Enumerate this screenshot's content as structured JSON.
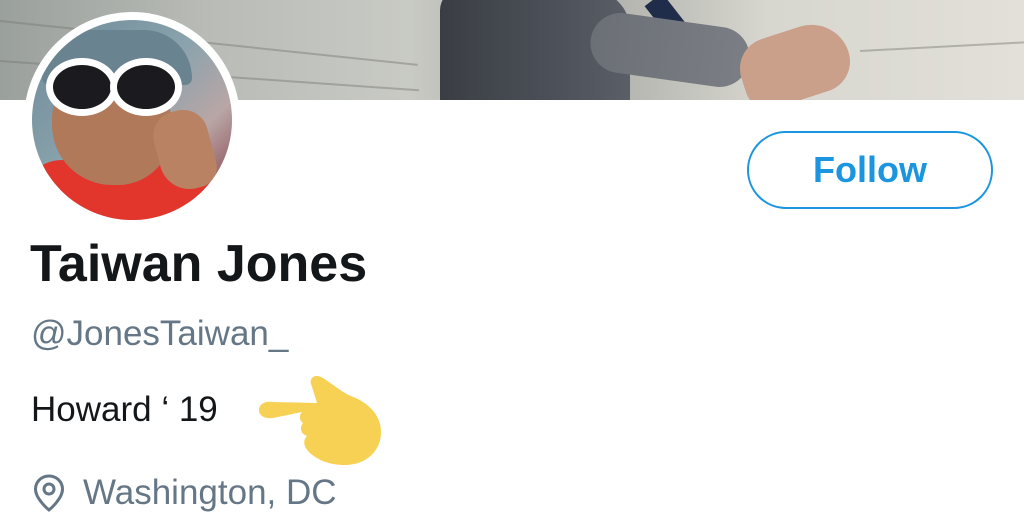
{
  "profile": {
    "display_name": "Taiwan Jones",
    "handle": "@JonesTaiwan_",
    "bio": "Howard ‘ 19",
    "location": "Washington, DC"
  },
  "actions": {
    "follow_label": "Follow"
  },
  "icons": {
    "location": "location-pin-icon",
    "bio_decoration": "pointing-hand-icon"
  },
  "colors": {
    "accent": "#1b95e0",
    "text_primary": "#14171a",
    "text_secondary": "#657786",
    "pointing_hand": "#f7d153"
  }
}
